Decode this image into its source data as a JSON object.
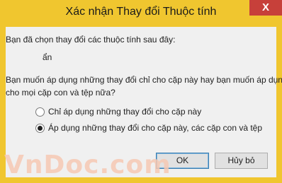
{
  "window": {
    "title": "Xác nhận Thay đổi Thuộc tính",
    "close_label": "X"
  },
  "dialog": {
    "intro": "Bạn đã chọn thay đổi các thuộc tính sau đây:",
    "attribute": "ẩn",
    "question_line1": "Bạn muốn áp dụng những thay đổi chỉ cho cặp này hay bạn muốn áp dụng",
    "question_line2": "cho mọi cặp con và tệp nữa?",
    "options": [
      {
        "label": "Chỉ áp dụng những thay đổi cho cặp này",
        "selected": false
      },
      {
        "label": "Áp dụng những thay đổi cho cặp này, các cặp con và tệp",
        "selected": true
      }
    ],
    "ok_label": "OK",
    "cancel_label": "Hủy bỏ"
  },
  "watermark": "VnDoc.com",
  "colors": {
    "titlebar": "#f0c62f",
    "close_button": "#c7403a",
    "dialog_background": "#f0f0f0"
  }
}
